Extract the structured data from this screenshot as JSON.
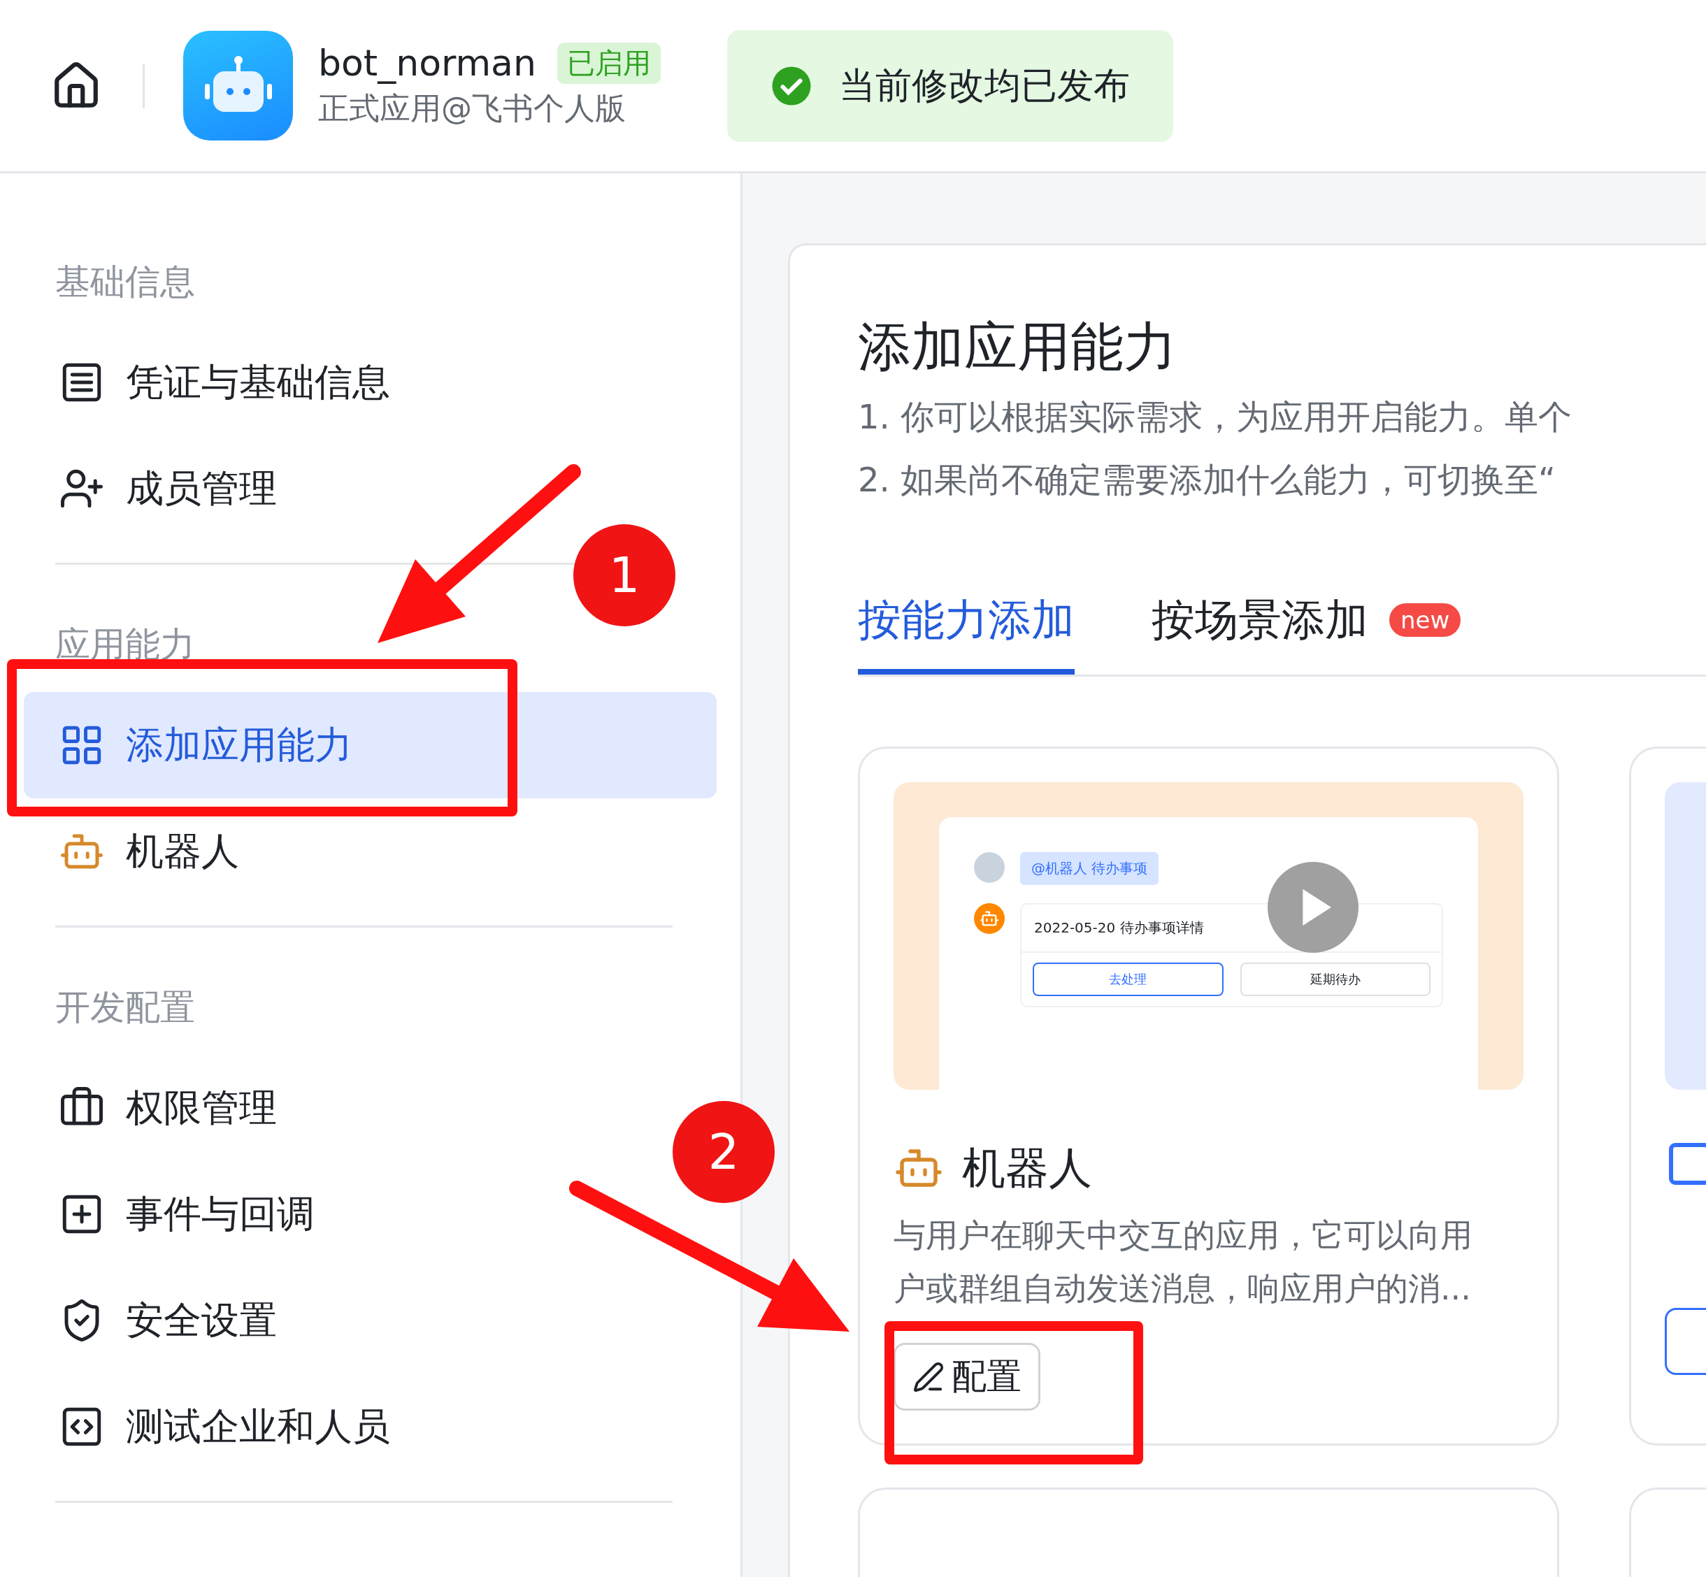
{
  "header": {
    "app_name": "bot_norman",
    "status_tag": "已启用",
    "app_subtitle": "正式应用@飞书个人版",
    "publish_notice": "当前修改均已发布"
  },
  "sidebar": {
    "sections": [
      {
        "title": "基础信息",
        "items": [
          {
            "label": "凭证与基础信息",
            "selected": false
          },
          {
            "label": "成员管理",
            "selected": false
          }
        ]
      },
      {
        "title": "应用能力",
        "items": [
          {
            "label": "添加应用能力",
            "selected": true
          },
          {
            "label": "机器人",
            "selected": false
          }
        ]
      },
      {
        "title": "开发配置",
        "items": [
          {
            "label": "权限管理",
            "selected": false
          },
          {
            "label": "事件与回调",
            "selected": false
          },
          {
            "label": "安全设置",
            "selected": false
          },
          {
            "label": "测试企业和人员",
            "selected": false
          }
        ]
      }
    ]
  },
  "main": {
    "title": "添加应用能力",
    "tips": [
      "1. 你可以根据实际需求，为应用开启能力。单个",
      "2. 如果尚不确定需要添加什么能力，可切换至“"
    ],
    "tabs": [
      {
        "label": "按能力添加",
        "selected": true
      },
      {
        "label": "按场景添加",
        "selected": false,
        "badge": "new"
      }
    ],
    "cards": [
      {
        "title": "机器人",
        "description": "与用户在聊天中交互的应用，它可以向用户或群组自动发送消息，响应用户的消...",
        "button": "配置",
        "preview": {
          "mention": "@机器人 待办事项",
          "message": "2022-05-20 待办事项详情",
          "actions": [
            {
              "label": "去处理",
              "primary": true
            },
            {
              "label": "延期待办",
              "primary": false
            }
          ]
        }
      }
    ]
  },
  "annotations": [
    {
      "number": "1"
    },
    {
      "number": "2"
    }
  ]
}
